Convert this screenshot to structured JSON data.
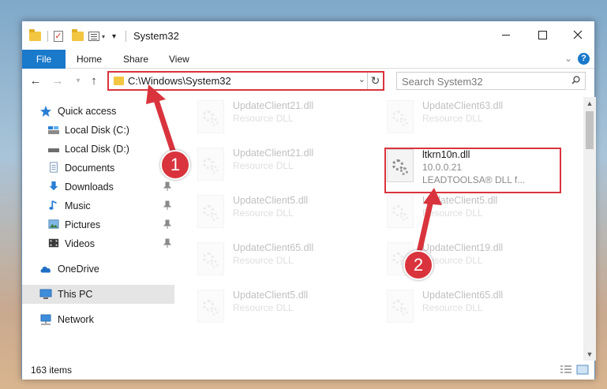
{
  "window": {
    "title": "System32",
    "controls": {
      "minimize": "minimize",
      "maximize": "maximize",
      "close": "close"
    }
  },
  "ribbon": {
    "tabs": [
      {
        "label": "File"
      },
      {
        "label": "Home"
      },
      {
        "label": "Share"
      },
      {
        "label": "View"
      }
    ],
    "help": "?"
  },
  "navigation": {
    "back": "←",
    "forward": "→",
    "recent": "▾",
    "up": "↑",
    "address": "C:\\Windows\\System32",
    "refresh": "↻",
    "search_placeholder": "Search System32"
  },
  "sidebar": {
    "items": [
      {
        "label": "Quick access",
        "icon": "star-icon",
        "pinned": false
      },
      {
        "label": "Local Disk (C:)",
        "icon": "drive-icon",
        "pinned": true
      },
      {
        "label": "Local Disk (D:)",
        "icon": "drive-icon",
        "pinned": true
      },
      {
        "label": "Documents",
        "icon": "documents-icon",
        "pinned": true
      },
      {
        "label": "Downloads",
        "icon": "downloads-icon",
        "pinned": true
      },
      {
        "label": "Music",
        "icon": "music-icon",
        "pinned": true
      },
      {
        "label": "Pictures",
        "icon": "pictures-icon",
        "pinned": true
      },
      {
        "label": "Videos",
        "icon": "videos-icon",
        "pinned": true
      },
      {
        "label": "OneDrive",
        "icon": "onedrive-icon",
        "pinned": false
      },
      {
        "label": "This PC",
        "icon": "this-pc-icon",
        "pinned": false,
        "selected": true
      },
      {
        "label": "Network",
        "icon": "network-icon",
        "pinned": false
      }
    ]
  },
  "files": {
    "col1": [
      {
        "name": "UpdateClient21.dll",
        "type": "Resource DLL"
      },
      {
        "name": "UpdateClient21.dll",
        "type": "Resource DLL"
      },
      {
        "name": "UpdateClient5.dll",
        "type": "Resource DLL"
      },
      {
        "name": "UpdateClient65.dll",
        "type": "Resource DLL"
      },
      {
        "name": "UpdateClient5.dll",
        "type": "Resource DLL"
      }
    ],
    "col2": [
      {
        "name": "UpdateClient63.dll",
        "type": "Resource DLL"
      },
      {
        "name": "ltkrn10n.dll",
        "version": "10.0.0.21",
        "type": "LEADTOOLSA® DLL f...",
        "highlighted": true
      },
      {
        "name": "UpdateClient5.dll",
        "type": "Resource DLL"
      },
      {
        "name": "UpdateClient19.dll",
        "type": "Resource DLL"
      },
      {
        "name": "UpdateClient65.dll",
        "type": "Resource DLL"
      }
    ]
  },
  "status": {
    "item_count": "163 items"
  },
  "annotations": {
    "step1": "1",
    "step2": "2",
    "color": "#d9343d"
  }
}
